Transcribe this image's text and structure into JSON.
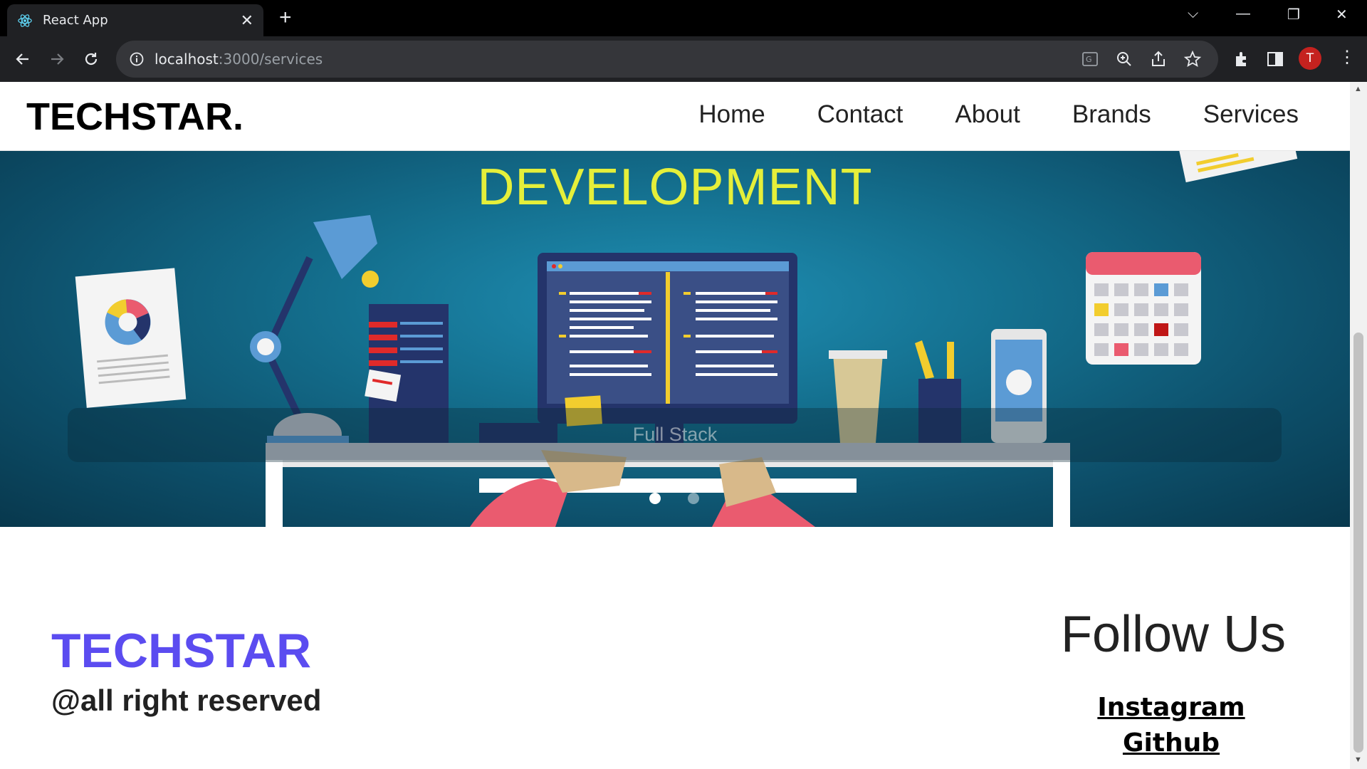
{
  "browser": {
    "tab_title": "React App",
    "url_host": "localhost",
    "url_path": ":3000/services",
    "avatar_letter": "T"
  },
  "site": {
    "logo": "TECHSTAR.",
    "nav": [
      "Home",
      "Contact",
      "About",
      "Brands",
      "Services"
    ]
  },
  "hero": {
    "title": "DEVELOPMENT",
    "caption": "Full Stack",
    "slides_count": 2,
    "active_slide": 1
  },
  "footer": {
    "brand": "TECHSTAR",
    "rights": "@all right reserved",
    "follow_title": "Follow Us",
    "social_links": [
      "Instagram",
      "Github"
    ]
  },
  "colors": {
    "brand_purple": "#5b4cf0",
    "hero_title": "#e5ef3a",
    "hero_bg": "#14708f"
  }
}
